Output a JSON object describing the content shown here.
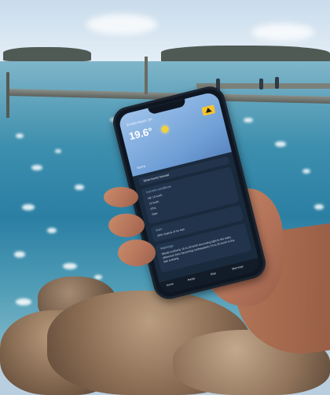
{
  "phone": {
    "location": "St Kilda Beach, SA",
    "temperature": "19.6°",
    "condition": "Sunny",
    "hint_1": "Show hourly forecast",
    "section_conditions": "Current conditions",
    "rows": [
      "NE 10 km/h",
      "10 km/h",
      "67%",
      "Rain"
    ],
    "section_rain": "Rain",
    "rain_text": "25% chance of no rain",
    "section_warning": "Warnings",
    "warning_text": "Winds northerly 15 to 20 km/h becoming light in the early afternoon then becoming northeasterly 15 to 20 km/h in the late evening.",
    "tabs": [
      "Home",
      "Radar",
      "Map",
      "Warnings"
    ]
  },
  "colors": {
    "sea": "#2b7fa3",
    "screen_header": "#7aa9dc",
    "warning_icon": "#f4c430"
  },
  "icons": [
    "sun-icon",
    "warning-icon"
  ]
}
